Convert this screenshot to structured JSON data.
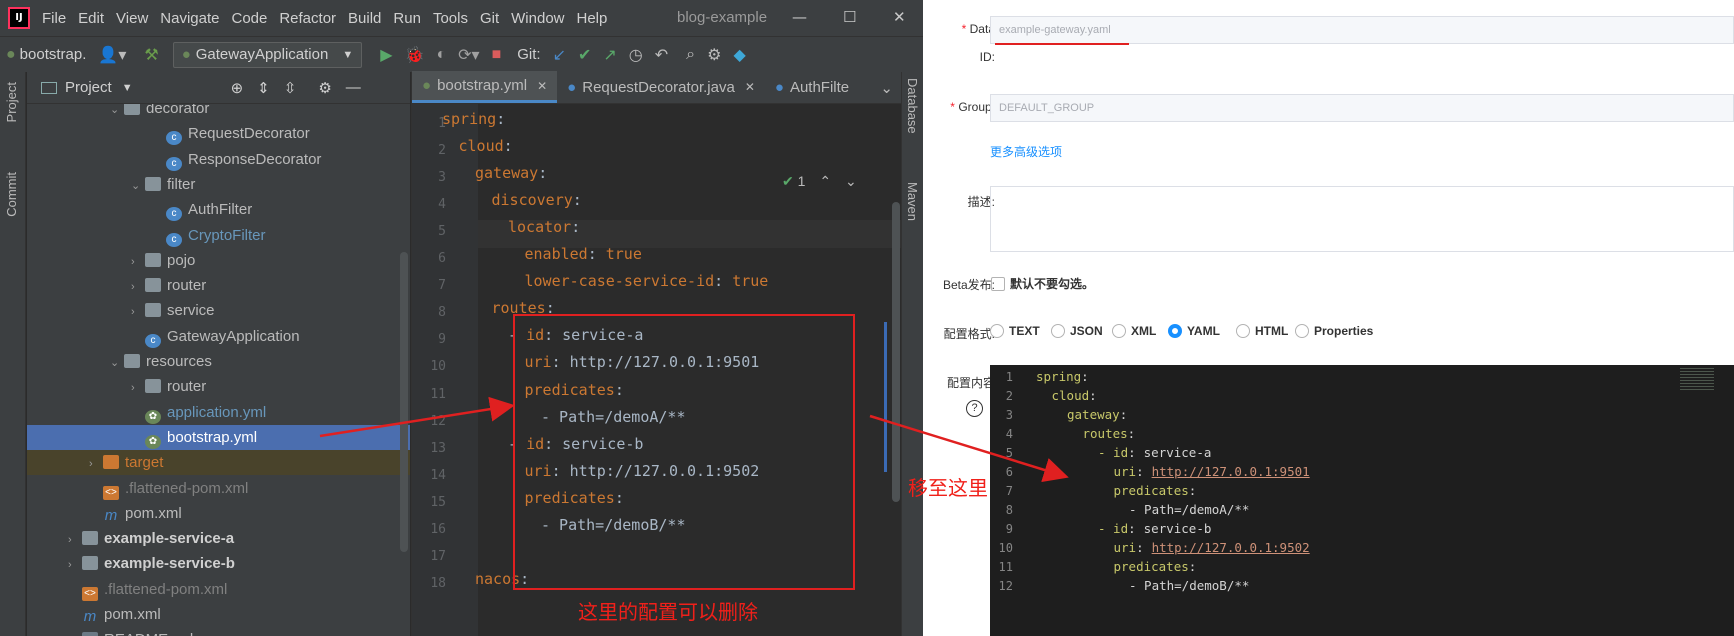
{
  "ide": {
    "logo": "IJ",
    "menu": [
      "File",
      "Edit",
      "View",
      "Navigate",
      "Code",
      "Refactor",
      "Build",
      "Run",
      "Tools",
      "Git",
      "Window",
      "Help"
    ],
    "window_title": "blog-example",
    "breadcrumb": "bootstrap.",
    "run_config": "GatewayApplication",
    "git_label": "Git:",
    "project_title": "Project",
    "left_tabs": [
      "Project",
      "Commit"
    ],
    "right_tabs": [
      "Database",
      "Maven"
    ],
    "tree": [
      {
        "label": "decorator",
        "icon": "folder",
        "indent": 3,
        "arrow": "down"
      },
      {
        "label": "RequestDecorator",
        "icon": "class",
        "indent": 5,
        "arrow": ""
      },
      {
        "label": "ResponseDecorator",
        "icon": "class",
        "indent": 5,
        "arrow": ""
      },
      {
        "label": "filter",
        "icon": "folder",
        "indent": 4,
        "arrow": "down"
      },
      {
        "label": "AuthFilter",
        "icon": "class",
        "indent": 5,
        "arrow": ""
      },
      {
        "label": "CryptoFilter",
        "icon": "class",
        "indent": 5,
        "arrow": "",
        "color": "#6897bb"
      },
      {
        "label": "pojo",
        "icon": "folder",
        "indent": 4,
        "arrow": "right"
      },
      {
        "label": "router",
        "icon": "folder",
        "indent": 4,
        "arrow": "right"
      },
      {
        "label": "service",
        "icon": "folder",
        "indent": 4,
        "arrow": "right"
      },
      {
        "label": "GatewayApplication",
        "icon": "class",
        "indent": 4,
        "arrow": ""
      },
      {
        "label": "resources",
        "icon": "folder",
        "indent": 3,
        "arrow": "down"
      },
      {
        "label": "router",
        "icon": "folder",
        "indent": 4,
        "arrow": "right"
      },
      {
        "label": "application.yml",
        "icon": "yml",
        "indent": 4,
        "arrow": "",
        "color": "#6897bb"
      },
      {
        "label": "bootstrap.yml",
        "icon": "yml",
        "indent": 4,
        "arrow": "",
        "selected": true
      },
      {
        "label": "target",
        "icon": "folder-target",
        "indent": 2,
        "arrow": "right",
        "color": "#cc7832",
        "highlight": true
      },
      {
        "label": ".flattened-pom.xml",
        "icon": "xml",
        "indent": 2,
        "arrow": "",
        "color": "#808080"
      },
      {
        "label": "pom.xml",
        "icon": "maven",
        "indent": 2,
        "arrow": ""
      },
      {
        "label": "example-service-a",
        "icon": "module",
        "indent": 1,
        "arrow": "right",
        "bold": true
      },
      {
        "label": "example-service-b",
        "icon": "module",
        "indent": 1,
        "arrow": "right",
        "bold": true
      },
      {
        "label": ".flattened-pom.xml",
        "icon": "xml",
        "indent": 1,
        "arrow": "",
        "color": "#808080"
      },
      {
        "label": "pom.xml",
        "icon": "maven",
        "indent": 1,
        "arrow": ""
      },
      {
        "label": "README.md",
        "icon": "md",
        "indent": 1,
        "arrow": ""
      }
    ],
    "editor_tabs": [
      "bootstrap.yml",
      "RequestDecorator.java",
      "AuthFilte"
    ],
    "inspection_count": "1",
    "code_lines": [
      {
        "n": "1",
        "indent": 0,
        "key": "spring",
        "val": ""
      },
      {
        "n": "2",
        "indent": 1,
        "key": "cloud",
        "val": ""
      },
      {
        "n": "3",
        "indent": 2,
        "key": "gateway",
        "val": ""
      },
      {
        "n": "4",
        "indent": 3,
        "key": "discovery",
        "val": ""
      },
      {
        "n": "5",
        "indent": 4,
        "key": "locator",
        "val": ""
      },
      {
        "n": "6",
        "indent": 5,
        "key": "enabled",
        "val": "true",
        "valcls": "k"
      },
      {
        "n": "7",
        "indent": 5,
        "key": "lower-case-service-id",
        "val": "true",
        "valcls": "k"
      },
      {
        "n": "8",
        "indent": 3,
        "key": "routes",
        "val": ""
      },
      {
        "n": "9",
        "indent": 4,
        "key": "- id",
        "val": "service-a",
        "dash": true
      },
      {
        "n": "10",
        "indent": 5,
        "key": "uri",
        "val": "http://127.0.0.1:9501"
      },
      {
        "n": "11",
        "indent": 5,
        "key": "predicates",
        "val": ""
      },
      {
        "n": "12",
        "indent": 6,
        "key": "- Path=/demoA/**",
        "val": "",
        "plain": true
      },
      {
        "n": "13",
        "indent": 4,
        "key": "- id",
        "val": "service-b",
        "dash": true
      },
      {
        "n": "14",
        "indent": 5,
        "key": "uri",
        "val": "http://127.0.0.1:9502"
      },
      {
        "n": "15",
        "indent": 5,
        "key": "predicates",
        "val": ""
      },
      {
        "n": "16",
        "indent": 6,
        "key": "- Path=/demoB/**",
        "val": "",
        "plain": true
      },
      {
        "n": "17",
        "indent": 0,
        "key": "",
        "val": ""
      },
      {
        "n": "18",
        "indent": 2,
        "key": "nacos",
        "val": ""
      }
    ]
  },
  "annotations": {
    "delete_note": "这里的配置可以删除",
    "move_note": "移至这里"
  },
  "form": {
    "data_id_label": "Data",
    "data_id_label2": "ID:",
    "data_id_value": "example-gateway.yaml",
    "group_label": "Group:",
    "group_value": "DEFAULT_GROUP",
    "advanced_link": "更多高级选项",
    "desc_label": "描述:",
    "beta_label": "Beta发布:",
    "beta_text": "默认不要勾选。",
    "format_label": "配置格式:",
    "formats": [
      "TEXT",
      "JSON",
      "XML",
      "YAML",
      "HTML",
      "Properties"
    ],
    "selected_format": "YAML",
    "content_label": "配置内容",
    "help_icon": "?",
    "accent": "#1890ff",
    "config_lines": [
      {
        "n": "1",
        "indent": 0,
        "key": "spring",
        "val": ""
      },
      {
        "n": "2",
        "indent": 1,
        "key": "cloud",
        "val": ""
      },
      {
        "n": "3",
        "indent": 2,
        "key": "gateway",
        "val": ""
      },
      {
        "n": "4",
        "indent": 3,
        "key": "routes",
        "val": ""
      },
      {
        "n": "5",
        "indent": 4,
        "key": "- id",
        "val": "service-a"
      },
      {
        "n": "6",
        "indent": 5,
        "key": "uri",
        "val": "http://127.0.0.1:9501",
        "url": true
      },
      {
        "n": "7",
        "indent": 5,
        "key": "predicates",
        "val": ""
      },
      {
        "n": "8",
        "indent": 6,
        "key": "- Path=/demoA/**",
        "val": "",
        "plain": true
      },
      {
        "n": "9",
        "indent": 4,
        "key": "- id",
        "val": "service-b"
      },
      {
        "n": "10",
        "indent": 5,
        "key": "uri",
        "val": "http://127.0.0.1:9502",
        "url": true
      },
      {
        "n": "11",
        "indent": 5,
        "key": "predicates",
        "val": ""
      },
      {
        "n": "12",
        "indent": 6,
        "key": "- Path=/demoB/**",
        "val": "",
        "plain": true
      }
    ]
  }
}
